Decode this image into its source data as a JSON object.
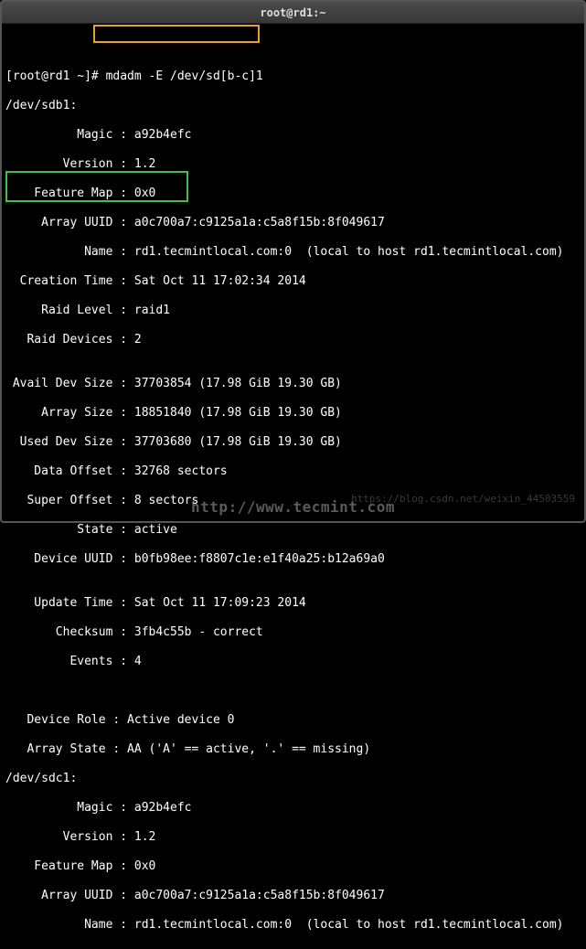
{
  "title": "root@rd1:~",
  "prompt": "[root@rd1 ~]",
  "command": "# mdadm -E /dev/sd[b-c]1",
  "dev1": "/dev/sdb1:",
  "fields1": {
    "magic": "          Magic : a92b4efc",
    "version": "        Version : 1.2",
    "feature_map": "    Feature Map : 0x0",
    "array_uuid": "     Array UUID : a0c700a7:c9125a1a:c5a8f15b:8f049617",
    "name": "           Name : rd1.tecmintlocal.com:0  (local to host rd1.tecmintlocal.com)",
    "creation": "  Creation Time : Sat Oct 11 17:02:34 2014",
    "raid_level": "     Raid Level : raid1",
    "raid_devices": "   Raid Devices : 2",
    "blank1": "",
    "avail_dev": " Avail Dev Size : 37703854 (17.98 GiB 19.30 GB)",
    "array_size": "     Array Size : 18851840 (17.98 GiB 19.30 GB)",
    "used_dev": "  Used Dev Size : 37703680 (17.98 GiB 19.30 GB)",
    "data_offset": "    Data Offset : 32768 sectors",
    "super_offset": "   Super Offset : 8 sectors",
    "state": "          State : active",
    "device_uuid": "    Device UUID : b0fb98ee:f8807c1e:e1f40a25:b12a69a0",
    "blank2": "",
    "update_time": "    Update Time : Sat Oct 11 17:09:23 2014",
    "checksum": "       Checksum : 3fb4c55b - correct",
    "events": "         Events : 4",
    "blank3": "",
    "blank4": "",
    "device_role": "   Device Role : Active device 0",
    "array_state": "   Array State : AA ('A' == active, '.' == missing)"
  },
  "dev2": "/dev/sdc1:",
  "fields2": {
    "magic": "          Magic : a92b4efc",
    "version": "        Version : 1.2",
    "feature_map": "    Feature Map : 0x0",
    "array_uuid": "     Array UUID : a0c700a7:c9125a1a:c5a8f15b:8f049617",
    "name": "           Name : rd1.tecmintlocal.com:0  (local to host rd1.tecmintlocal.com)"
  },
  "watermark": "http://www.tecmint.com",
  "watermark2": "https://blog.csdn.net/weixin_44503559"
}
